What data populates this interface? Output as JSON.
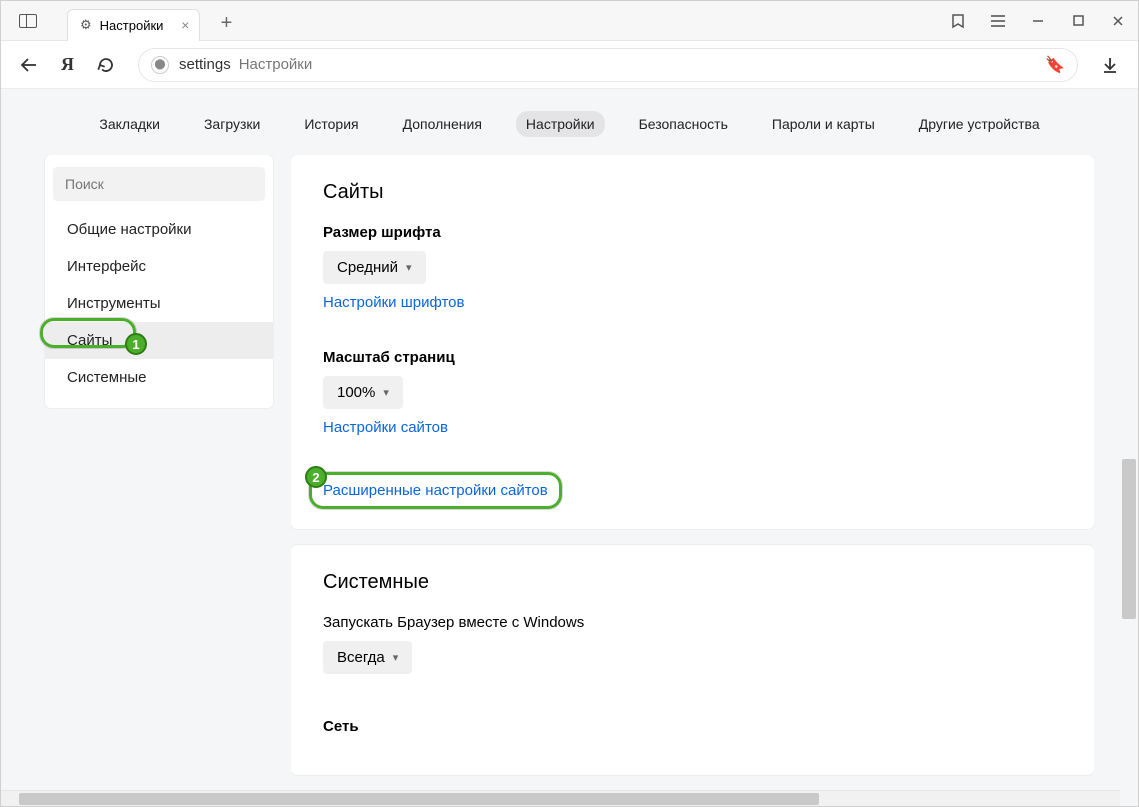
{
  "tab": {
    "title": "Настройки"
  },
  "omnibox": {
    "path": "settings",
    "label": "Настройки"
  },
  "topnav": {
    "items": [
      "Закладки",
      "Загрузки",
      "История",
      "Дополнения",
      "Настройки",
      "Безопасность",
      "Пароли и карты",
      "Другие устройства"
    ],
    "active_index": 4
  },
  "sidebar": {
    "search_placeholder": "Поиск",
    "items": [
      "Общие настройки",
      "Интерфейс",
      "Инструменты",
      "Сайты",
      "Системные"
    ],
    "active_index": 3
  },
  "sites_card": {
    "heading": "Сайты",
    "font_size_label": "Размер шрифта",
    "font_size_value": "Средний",
    "font_settings_link": "Настройки шрифтов",
    "zoom_label": "Масштаб страниц",
    "zoom_value": "100%",
    "site_settings_link": "Настройки сайтов",
    "advanced_link": "Расширенные настройки сайтов"
  },
  "system_card": {
    "heading": "Системные",
    "autostart_label": "Запускать Браузер вместе с Windows",
    "autostart_value": "Всегда",
    "network_label": "Сеть"
  },
  "annotations": {
    "badge1": "1",
    "badge2": "2"
  }
}
